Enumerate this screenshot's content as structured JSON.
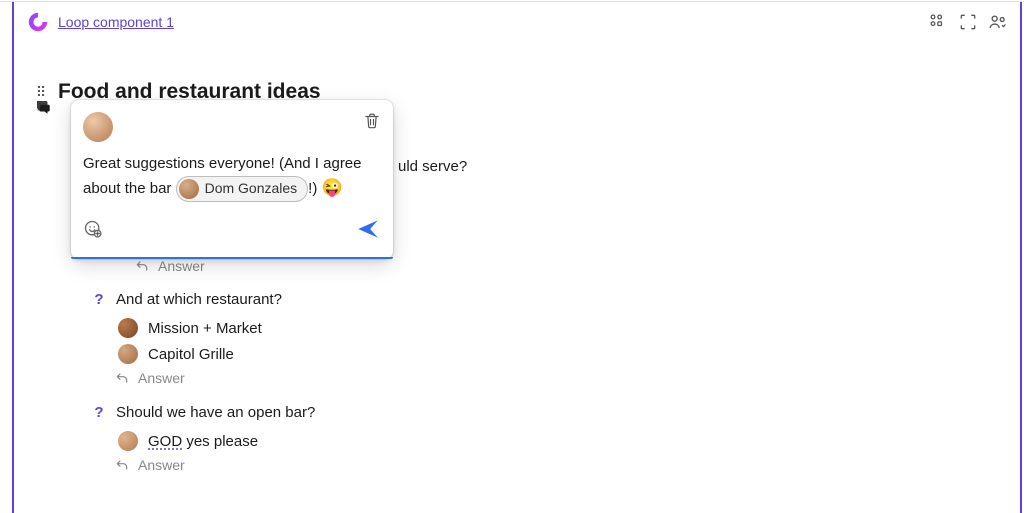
{
  "header": {
    "link_text": "Loop component 1"
  },
  "heading": "Food and restaurant ideas",
  "comment": {
    "text_before": "Great suggestions everyone! (And I agree about the bar ",
    "mention_name": "Dom Gonzales",
    "text_after": "!) ",
    "reaction_emoji": "😜"
  },
  "partial_question_tail": "uld serve?",
  "answer_label": "Answer",
  "qa": [
    {
      "question": "And at which restaurant?",
      "answers": [
        {
          "text": "Mission + Market"
        },
        {
          "text": "Capitol Grille"
        }
      ]
    },
    {
      "question": "Should we have an open bar?",
      "answers": [
        {
          "text_emphasis": "GOD",
          "text_rest": " yes please"
        }
      ]
    }
  ]
}
